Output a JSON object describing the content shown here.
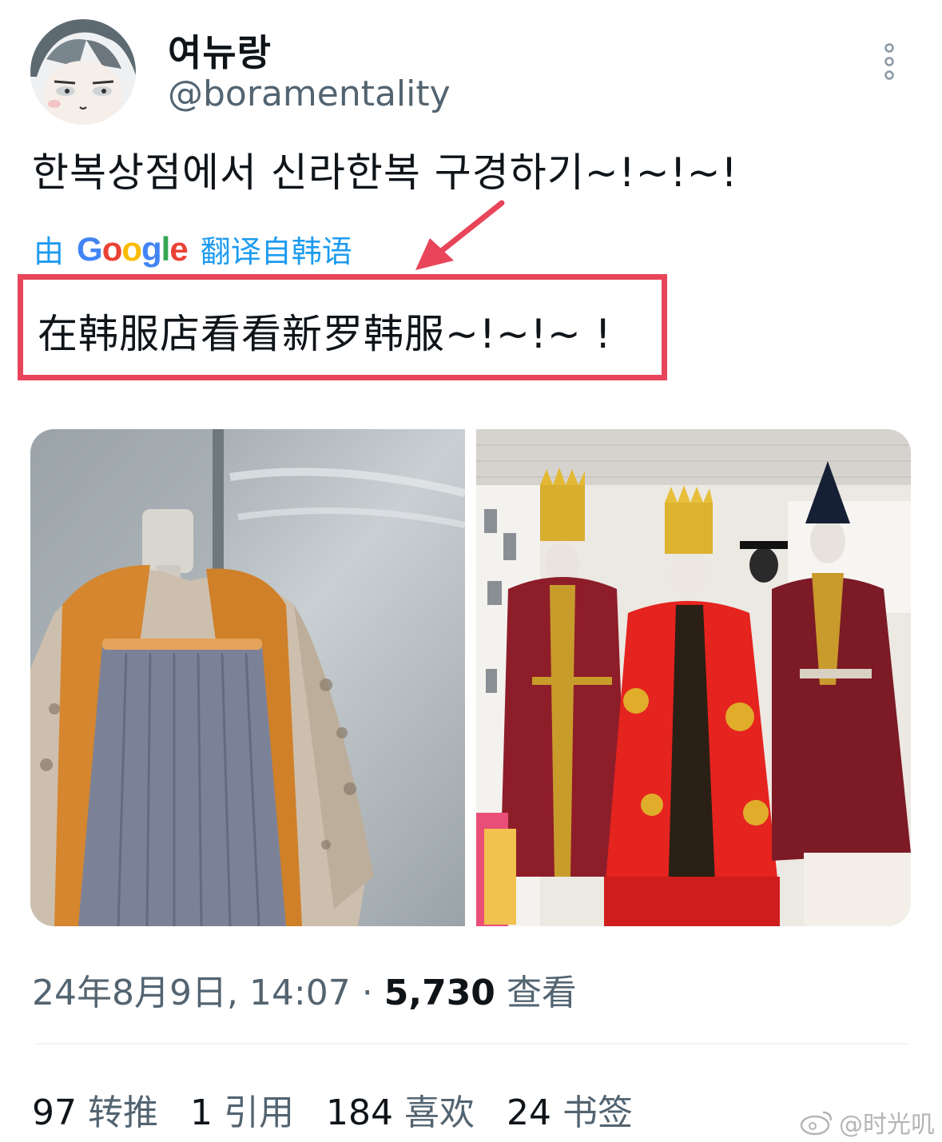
{
  "author": {
    "display_name": "여뉴랑",
    "handle": "@boramentality"
  },
  "tweet": {
    "text": "한복상점에서 신라한복 구경하기~!~!~!",
    "translate_prefix": "由",
    "translate_brand": [
      "G",
      "o",
      "o",
      "g",
      "l",
      "e"
    ],
    "translate_suffix": "翻译自韩语",
    "translated_text": "在韩服店看看新罗韩服~!~!~ !"
  },
  "meta": {
    "date_time": "24年8月9日, 14:07",
    "separator": "·",
    "views_count": "5,730",
    "views_label": "查看"
  },
  "stats": [
    {
      "count": "97",
      "label": "转推"
    },
    {
      "count": "1",
      "label": "引用"
    },
    {
      "count": "184",
      "label": "喜欢"
    },
    {
      "count": "24",
      "label": "书签"
    }
  ],
  "watermark": {
    "text": "@时光叽",
    "icon": "weibo-icon"
  },
  "icons": {
    "more": "more-vertical-icon",
    "annotation": "red-arrow-icon"
  },
  "colors": {
    "link": "#1d9bf0",
    "highlight": "#e8455a",
    "muted": "#536471"
  }
}
